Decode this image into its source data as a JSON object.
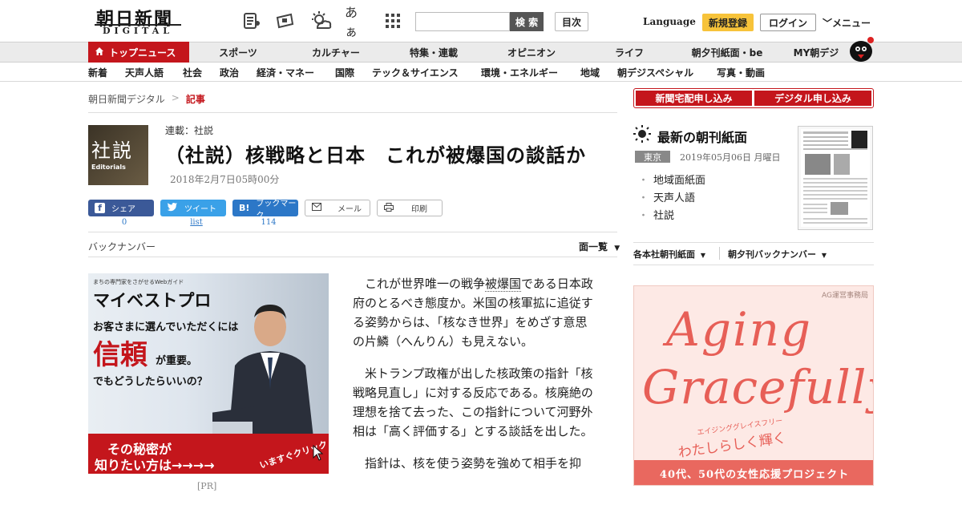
{
  "header": {
    "logo_main": "朝日新聞",
    "logo_sub": "DIGITAL",
    "font_size_icon_label": "あぁ",
    "search_placeholder": "",
    "search_button": "検 索",
    "toc_button": "目次",
    "language": "Language",
    "signup": "新規登録",
    "login": "ログイン",
    "menu": "メニュー"
  },
  "nav_primary": {
    "top": "トップニュース",
    "items": [
      "スポーツ",
      "カルチャー",
      "特集・連載",
      "オピニオン",
      "ライフ",
      "朝夕刊紙面・be",
      "MY朝デジ"
    ]
  },
  "nav_secondary": {
    "items": [
      "新着",
      "天声人語",
      "社会",
      "政治",
      "経済・マネー",
      "国際",
      "テック＆サイエンス",
      "環境・エネルギー",
      "地域",
      "朝デジスペシャル",
      "写真・動画"
    ]
  },
  "breadcrumb": {
    "home": "朝日新聞デジタル",
    "sep": ">",
    "current": "記事"
  },
  "article": {
    "badge_kanji": "社説",
    "badge_english": "Editorials",
    "series": "連載：社説",
    "headline": "（社説）核戦略と日本　これが被爆国の談話か",
    "date": "2018年2月7日05時00分",
    "share": {
      "facebook": "シェア",
      "twitter": "ツイート",
      "hatena": "ブックマーク",
      "mail": "メール",
      "print": "印刷",
      "facebook_count": "0",
      "twitter_count": "list",
      "hatena_count": "114"
    },
    "backnumber": "バックナンバー",
    "pages_list": "面一覧",
    "paragraphs": [
      {
        "before": "これが世界唯一の戦争",
        "link": "被爆国",
        "after": "である日本政府のとるべき態度か。米国の核軍拡に追従する姿勢からは、「核なき世界」をめざす意思の片鱗（へんりん）も見えない。"
      },
      {
        "before": "米トランプ政権が出した核政策の指針「核戦略見直し」に対する反応である。核廃絶の理想を捨て去った、この指針について河野外相は「高く評価する」とする談話を出した。",
        "link": "",
        "after": ""
      },
      {
        "before": "指針は、核を使う姿勢を強めて相手を抑",
        "link": "",
        "after": ""
      }
    ]
  },
  "ad_left": {
    "tagline": "まちの専門家をさがせるWebガイド",
    "brand": "マイベストプロ",
    "line1": "お客さまに選んでいただくには",
    "big": "信頼",
    "line2": "が重要。",
    "line3": "でもどうしたらいいの？",
    "bottom1": "その秘密が",
    "bottom2": "知りたい方は→→→→",
    "cta": "いますぐクリック",
    "label": "[PR]"
  },
  "sidebar": {
    "sub_home": "新聞宅配申し込み",
    "sub_digital": "デジタル申し込み",
    "morning_title": "最新の朝刊紙面",
    "region": "東京",
    "edition_date": "2019年05月06日 月曜日",
    "links": [
      "地域面紙面",
      "天声人語",
      "社説"
    ],
    "main_edition": "各本社朝刊紙面",
    "evening_backnumber": "朝夕刊バックナンバー"
  },
  "ad_right": {
    "sponsor": "AG運営事務局",
    "line1": "Aging",
    "line2": "Gracefully",
    "kana": "エイジンググレイスフリー",
    "tagline": "わたしらしく輝く",
    "bottom": "40代、50代の女性応援プロジェクト"
  },
  "colors": {
    "brand_red": "#c4161c",
    "signup_yellow": "#f7c33a",
    "facebook": "#3b5998",
    "twitter": "#3aa1e8",
    "hatena": "#2c77c7",
    "ad_coral": "#e75f57"
  }
}
